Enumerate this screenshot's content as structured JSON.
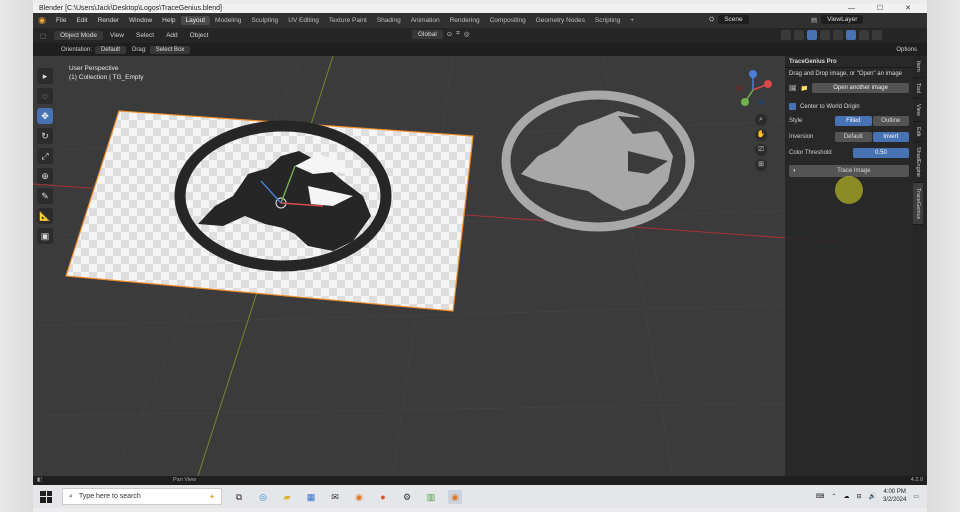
{
  "window": {
    "title": "Blender [C:\\Users\\Jack\\Desktop\\Logos\\TraceGenius.blend]",
    "buttons": [
      "—",
      "☐",
      "✕"
    ]
  },
  "menubar": {
    "menus": [
      "File",
      "Edit",
      "Render",
      "Window",
      "Help"
    ],
    "workspaces": [
      "Layout",
      "Modeling",
      "Sculpting",
      "UV Editing",
      "Texture Paint",
      "Shading",
      "Animation",
      "Rendering",
      "Compositing",
      "Geometry Nodes",
      "Scripting"
    ],
    "active_workspace": "Layout",
    "add_tab": "+",
    "scene_label": "Scene",
    "view_layer_label": "ViewLayer"
  },
  "header": {
    "mode": "Object Mode",
    "menus": [
      "View",
      "Select",
      "Add",
      "Object"
    ],
    "transform": "Global",
    "options": "Options"
  },
  "subheader": {
    "orientation_label": "Orientation:",
    "orientation_value": "Default",
    "drag_label": "Drag:",
    "drag_value": "Select Box"
  },
  "viewport": {
    "info_line1": "User Perspective",
    "info_line2": "(1) Collection | TG_Empty",
    "tools": [
      "cursor",
      "select",
      "move",
      "rotate",
      "scale",
      "transform",
      "annotate",
      "measure",
      "add-cube"
    ]
  },
  "panel": {
    "title": "TraceGenius Pro",
    "hint": "Drag and Drop image, or \"Open\" an image",
    "open_button": "Open another image",
    "center_label": "Center to World Origin",
    "style_label": "Style",
    "style_options": [
      "Filled",
      "Outline"
    ],
    "style_selected": "Filled",
    "inversion_label": "Inversion",
    "inversion_options": [
      "Default",
      "Invert"
    ],
    "inversion_selected": "Invert",
    "threshold_label": "Color Threshold",
    "threshold_value": "0.50",
    "trace_button": "Trace Image"
  },
  "side_tabs": [
    "Item",
    "Tool",
    "View",
    "Edit",
    "ShadEngine",
    "TraceGenius"
  ],
  "status": {
    "pan": "Pan View",
    "version": "4.2.0"
  },
  "taskbar": {
    "search_placeholder": "Type here to search",
    "time": "4:00 PM",
    "date": "3/2/2024"
  },
  "colors": {
    "accent": "#4772b3",
    "viewport_bg": "#3b3b3b",
    "selection_outline": "#f09030"
  }
}
